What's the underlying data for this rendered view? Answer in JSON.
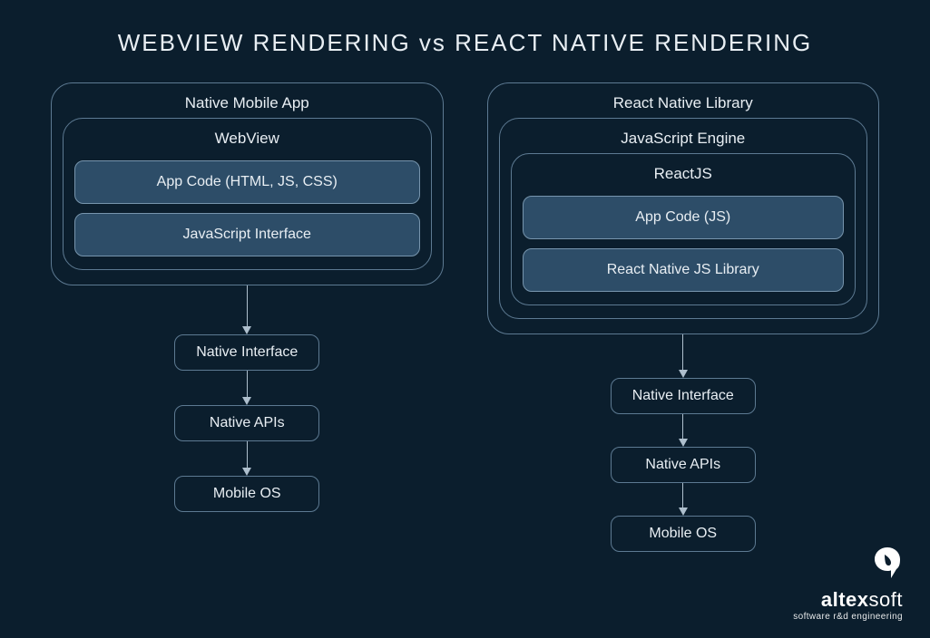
{
  "title": "WEBVIEW RENDERING vs REACT NATIVE RENDERING",
  "left": {
    "outer": "Native Mobile App",
    "inner": "WebView",
    "boxes": [
      "App Code (HTML, JS, CSS)",
      "JavaScript Interface"
    ],
    "chain": [
      "Native Interface",
      "Native APIs",
      "Mobile OS"
    ]
  },
  "right": {
    "outer": "React Native Library",
    "mid": "JavaScript Engine",
    "inner": "ReactJS",
    "boxes": [
      "App Code (JS)",
      "React Native JS Library"
    ],
    "chain": [
      "Native Interface",
      "Native APIs",
      "Mobile OS"
    ]
  },
  "logo": {
    "brand_bold": "altex",
    "brand_light": "soft",
    "tagline": "software r&d engineering"
  }
}
